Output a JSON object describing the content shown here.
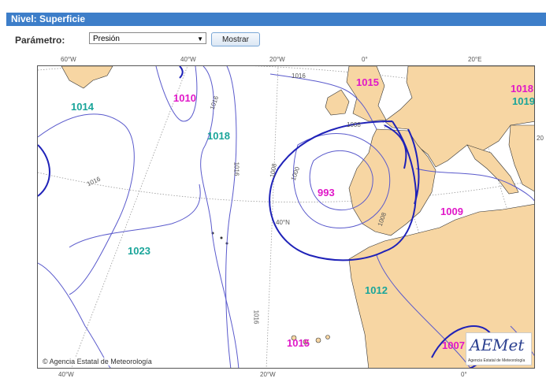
{
  "header": {
    "title": "Nivel: Superficie"
  },
  "form": {
    "param_label": "Parámetro:",
    "param_value": "Presión",
    "button_label": "Mostrar"
  },
  "map": {
    "top_lon_labels": [
      "60°W",
      "40°W",
      "20°W",
      "0°",
      "20°E"
    ],
    "bottom_lon_labels": [
      "40°W",
      "20°W",
      "0°"
    ],
    "lat_label": "40°N",
    "right_edge_label": "20",
    "highs": [
      "1014",
      "1018",
      "1023",
      "1012",
      "1019"
    ],
    "lows": [
      "1010",
      "1015",
      "993",
      "1009",
      "1018",
      "1015",
      "1007"
    ],
    "isobar_labels": [
      "1016",
      "1016",
      "1016",
      "1016",
      "1016",
      "1008",
      "1000",
      "1008",
      "1008",
      "1000"
    ],
    "credit": "Agencia Estatal de Meteorología",
    "credit_symbol": "©",
    "logo_text": "AEMet",
    "logo_subtext": "Agencia Estatal de Meteorología",
    "colors": {
      "land": "#f7d6a3",
      "sea": "#ffffff",
      "isobar": "#5a5acc",
      "thick_isobar": "#1f22b8",
      "high": "#1aa59a",
      "low": "#e018c8",
      "header": "#3d7ec9"
    }
  }
}
